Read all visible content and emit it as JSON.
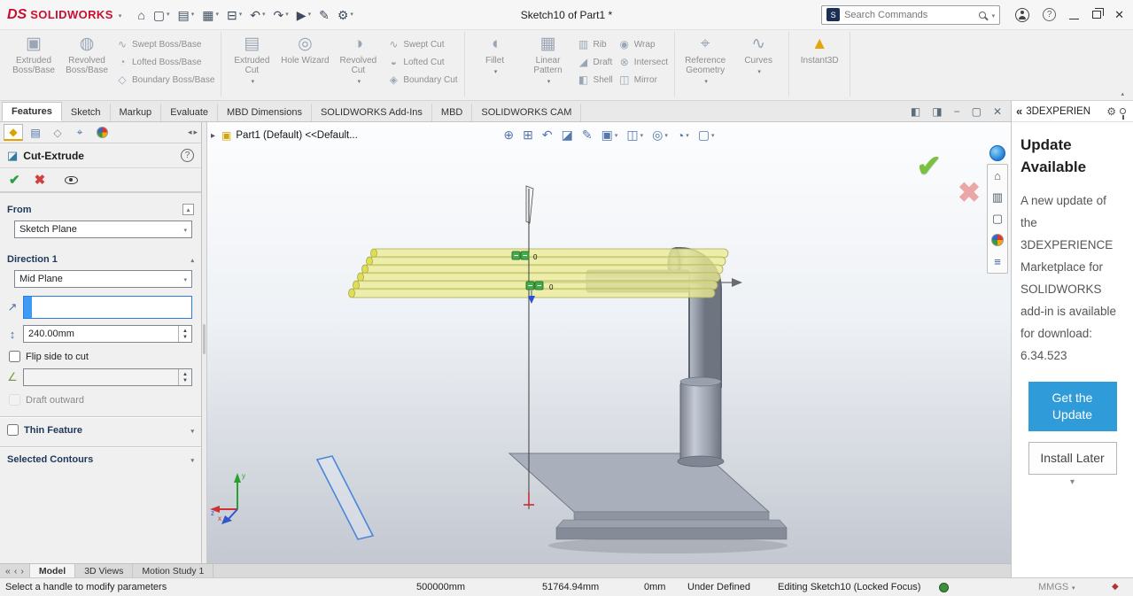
{
  "colors": {
    "brand_red": "#c8102e",
    "accent_blue": "#2f9bd8",
    "preview_yellow": "#ecec96",
    "confirm_green": "#79c143",
    "cancel_pink": "#eba6a6"
  },
  "titlebar": {
    "brand": "SOLIDWORKS",
    "title": "Sketch10 of Part1 *",
    "search_placeholder": "Search Commands",
    "qat": [
      {
        "name": "home",
        "glyph": "⌂"
      },
      {
        "name": "new-document",
        "glyph": "▢"
      },
      {
        "name": "open-document",
        "glyph": "▤"
      },
      {
        "name": "save",
        "glyph": "▦"
      },
      {
        "name": "print",
        "glyph": "⊟"
      },
      {
        "name": "undo",
        "glyph": "↶"
      },
      {
        "name": "redo",
        "glyph": "↷"
      },
      {
        "name": "select",
        "glyph": "▶"
      },
      {
        "name": "rebuild",
        "glyph": "✎"
      },
      {
        "name": "options",
        "glyph": "⚙"
      }
    ]
  },
  "ribbon": {
    "large": [
      {
        "label": "Extruded Boss/Base",
        "glyph": "▣"
      },
      {
        "label": "Revolved Boss/Base",
        "glyph": "◍"
      },
      {
        "label": "Extruded Cut",
        "glyph": "▤"
      },
      {
        "label": "Hole Wizard",
        "glyph": "◎"
      },
      {
        "label": "Revolved Cut",
        "glyph": "◑"
      },
      {
        "label": "Fillet",
        "glyph": "◖"
      },
      {
        "label": "Linear Pattern",
        "glyph": "▦"
      },
      {
        "label": "Reference Geometry",
        "glyph": "⌖"
      },
      {
        "label": "Curves",
        "glyph": "∿"
      },
      {
        "label": "Instant3D",
        "glyph": "▲"
      }
    ],
    "small": [
      {
        "label": "Swept Boss/Base",
        "glyph": "∿"
      },
      {
        "label": "Lofted Boss/Base",
        "glyph": "◔"
      },
      {
        "label": "Boundary Boss/Base",
        "glyph": "◇"
      },
      {
        "label": "Swept Cut",
        "glyph": "∿"
      },
      {
        "label": "Lofted Cut",
        "glyph": "◒"
      },
      {
        "label": "Boundary Cut",
        "glyph": "◈"
      },
      {
        "label": "Rib",
        "glyph": "▥"
      },
      {
        "label": "Draft",
        "glyph": "◢"
      },
      {
        "label": "Shell",
        "glyph": "◧"
      },
      {
        "label": "Wrap",
        "glyph": "◉"
      },
      {
        "label": "Intersect",
        "glyph": "⊗"
      },
      {
        "label": "Mirror",
        "glyph": "◫"
      }
    ]
  },
  "tabs": {
    "items": [
      "Features",
      "Sketch",
      "Markup",
      "Evaluate",
      "MBD Dimensions",
      "SOLIDWORKS Add-Ins",
      "MBD",
      "SOLIDWORKS CAM"
    ],
    "active": "Features"
  },
  "doc_controls": [
    {
      "name": "show-pane-left",
      "glyph": "◧"
    },
    {
      "name": "show-pane-right",
      "glyph": "◨"
    },
    {
      "name": "minimize-document",
      "glyph": "−"
    },
    {
      "name": "restore-document",
      "glyph": "▢"
    },
    {
      "name": "close-document",
      "glyph": "✕"
    }
  ],
  "property_manager": {
    "title": "Cut-Extrude",
    "sections": {
      "from": {
        "label": "From",
        "dropdown": "Sketch Plane"
      },
      "direction1": {
        "label": "Direction 1",
        "dropdown": "Mid Plane",
        "depth_value": "240.00mm",
        "flip_label": "Flip side to cut",
        "draft_value": "",
        "draft_label": "Draft outward"
      },
      "thin": {
        "label": "Thin Feature"
      },
      "contours": {
        "label": "Selected Contours"
      }
    }
  },
  "viewport": {
    "doc_label": "Part1 (Default) <<Default...",
    "zero_a": "0",
    "zero_b": "0"
  },
  "headsup": [
    {
      "name": "zoom-fit",
      "glyph": "⊕"
    },
    {
      "name": "zoom-area",
      "glyph": "⊞"
    },
    {
      "name": "previous-view",
      "glyph": "↶"
    },
    {
      "name": "section-view",
      "glyph": "◪"
    },
    {
      "name": "dynamic-annotation",
      "glyph": "✎"
    },
    {
      "name": "view-orientation",
      "glyph": "▣"
    },
    {
      "name": "display-style",
      "glyph": "◫"
    },
    {
      "name": "hide-show-items",
      "glyph": "◎"
    },
    {
      "name": "edit-appearance",
      "glyph": "◔"
    },
    {
      "name": "view-settings",
      "glyph": "▢"
    }
  ],
  "side_strip": [
    {
      "name": "3dexperience"
    },
    {
      "name": "home",
      "glyph": "⌂"
    },
    {
      "name": "design-library",
      "glyph": "▥"
    },
    {
      "name": "file-explorer",
      "glyph": "▢"
    },
    {
      "name": "appearances"
    },
    {
      "name": "custom-properties",
      "glyph": "≡"
    }
  ],
  "task_pane": {
    "header": "3DEXPERIEN",
    "title": "Update Available",
    "body": "A new update of the 3DEXPERIENCE Marketplace for SOLIDWORKS add-in is available for download: 6.34.523",
    "primary": "Get the Update",
    "secondary": "Install Later"
  },
  "model_tabs": {
    "items": [
      "Model",
      "3D Views",
      "Motion Study 1"
    ],
    "active": "Model"
  },
  "status_bar": {
    "hint": "Select a handle to modify parameters",
    "x": "500000mm",
    "y": "51764.94mm",
    "z": "0mm",
    "state": "Under Defined",
    "mode": "Editing Sketch10 (Locked Focus)",
    "units": "MMGS"
  }
}
